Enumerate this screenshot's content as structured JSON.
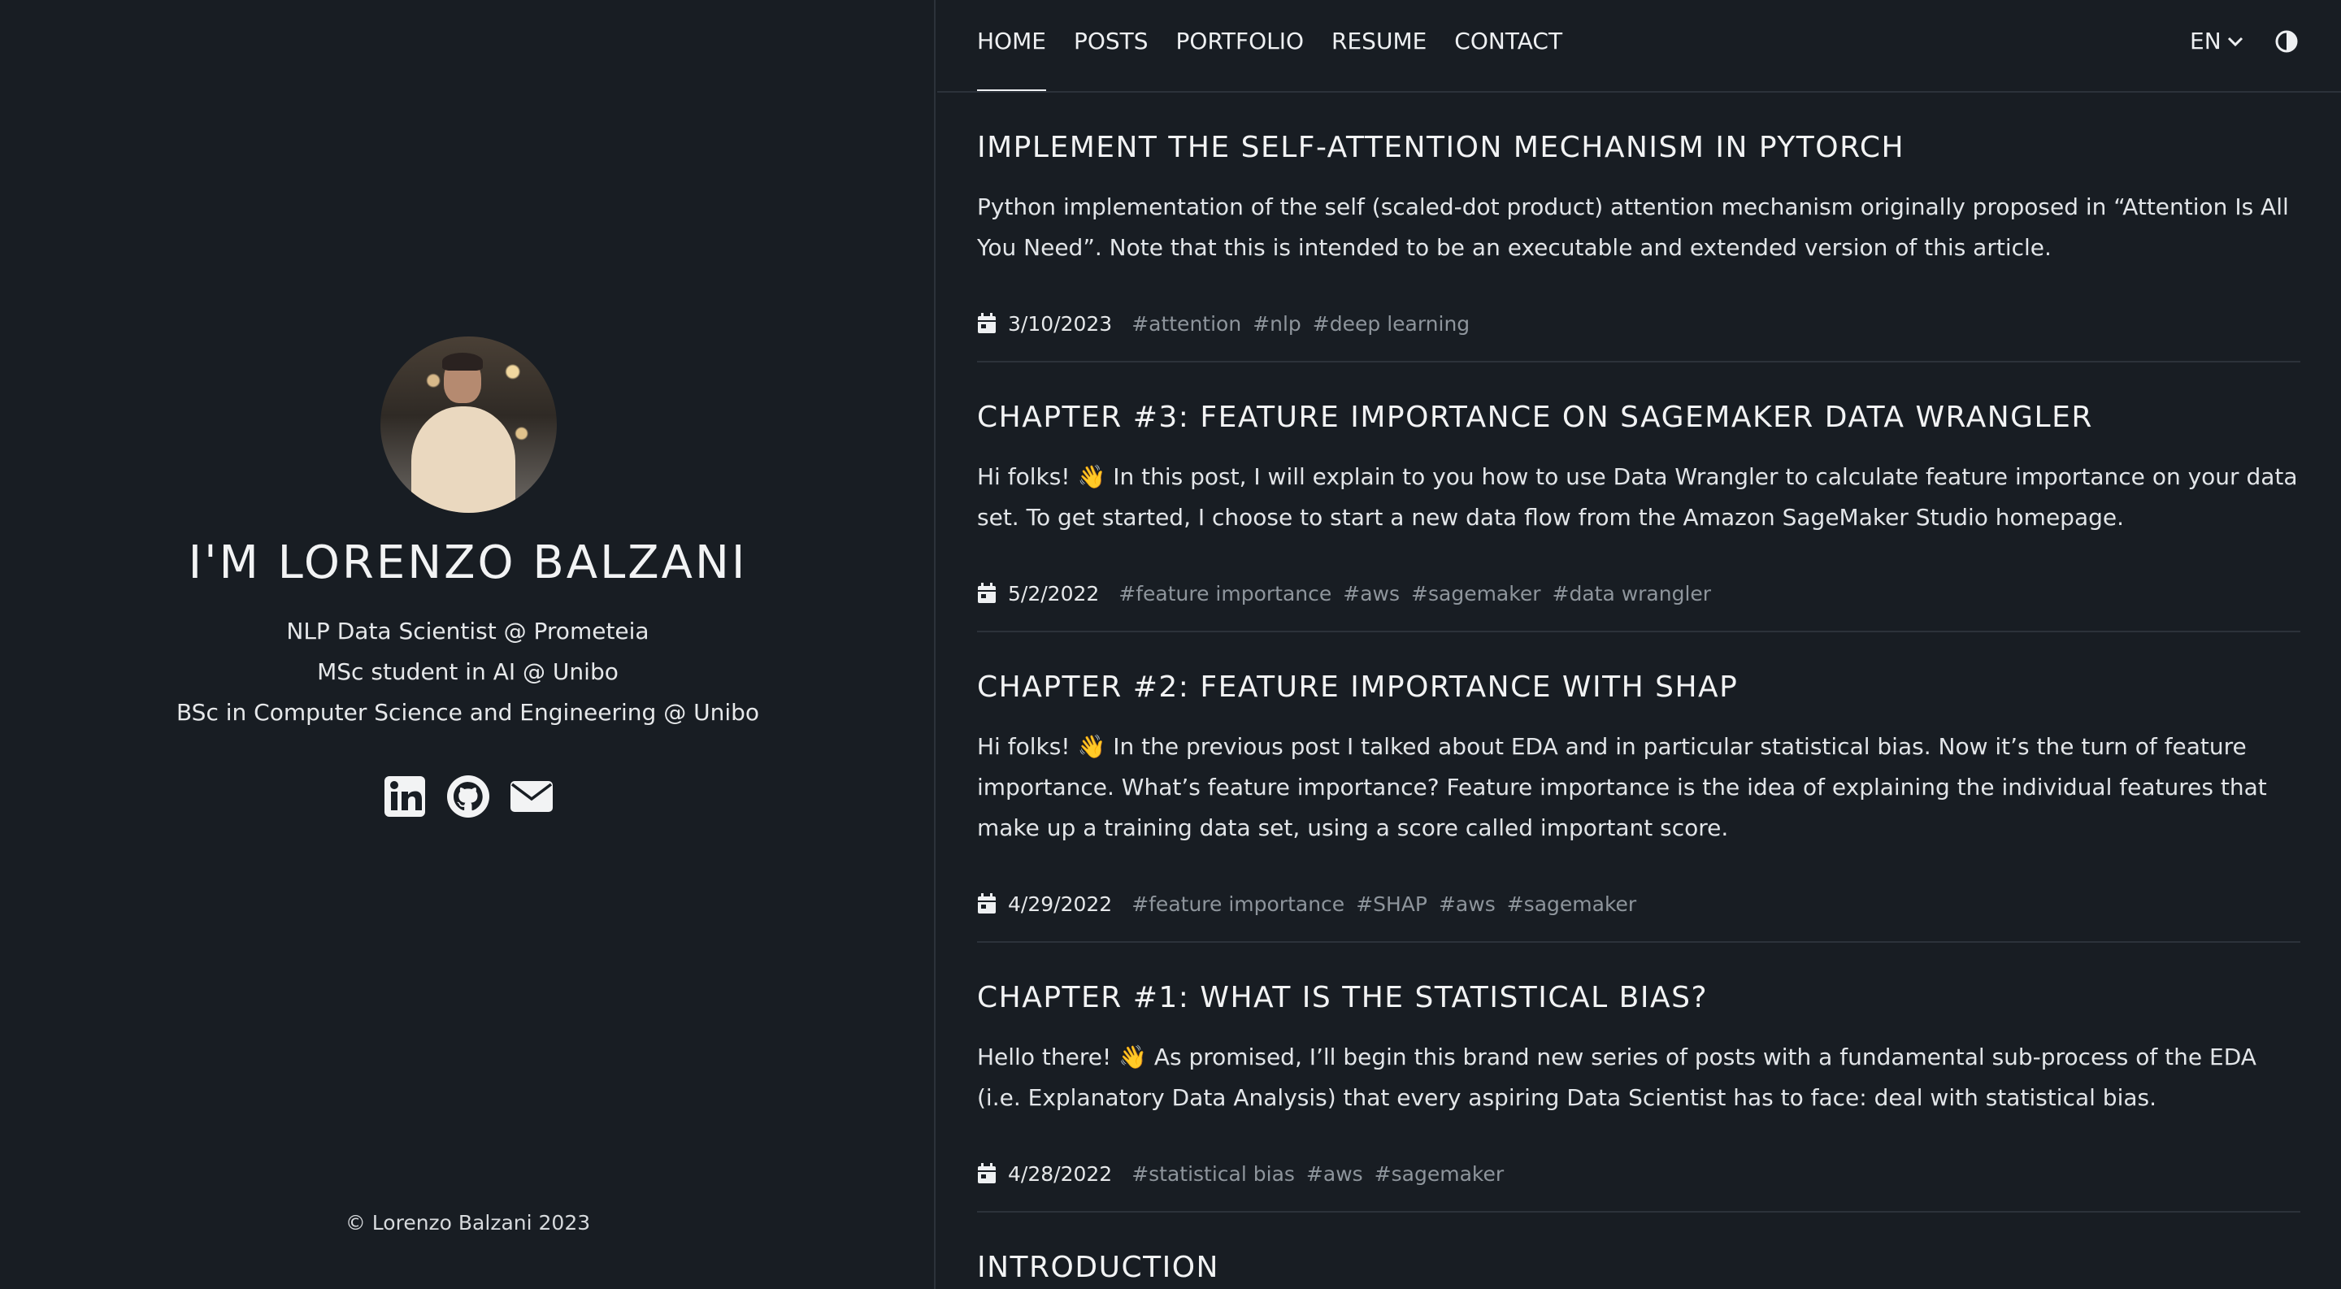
{
  "profile": {
    "title": "I'M LORENZO BALZANI",
    "lines": [
      "NLP Data Scientist @ Prometeia",
      "MSc student in AI @ Unibo",
      "BSc in Computer Science and Engineering @ Unibo"
    ],
    "socials": [
      "linkedin-icon",
      "github-icon",
      "envelope-icon"
    ],
    "copyright": "© Lorenzo Balzani 2023"
  },
  "nav": {
    "items": [
      {
        "label": "HOME",
        "active": true
      },
      {
        "label": "POSTS"
      },
      {
        "label": "PORTFOLIO"
      },
      {
        "label": "RESUME"
      },
      {
        "label": "CONTACT"
      }
    ],
    "language": "EN",
    "theme_icon": "contrast-icon"
  },
  "posts": [
    {
      "title": "IMPLEMENT THE SELF-ATTENTION MECHANISM IN PYTORCH",
      "excerpt": "Python implementation of the self (scaled-dot product) attention mechanism originally proposed in “Attention Is All You Need”. Note that this is intended to be an executable and extended version of this article.",
      "date": "3/10/2023",
      "tags": [
        "#attention",
        "#nlp",
        "#deep learning"
      ]
    },
    {
      "title": "CHAPTER #3: FEATURE IMPORTANCE ON SAGEMAKER DATA WRANGLER",
      "excerpt_before": "Hi folks!",
      "emoji": "👋",
      "excerpt": "In this post, I will explain to you how to use Data Wrangler to calculate feature importance on your data set. To get started, I choose to start a new data flow from the Amazon SageMaker Studio homepage.",
      "date": "5/2/2022",
      "tags": [
        "#feature importance",
        "#aws",
        "#sagemaker",
        "#data wrangler"
      ]
    },
    {
      "title": "CHAPTER #2: FEATURE IMPORTANCE WITH SHAP",
      "excerpt_before": "Hi folks!",
      "emoji": "👋",
      "excerpt": "In the previous post I talked about EDA and in particular statistical bias. Now it’s the turn of feature importance. What’s feature importance? Feature importance is the idea of explaining the individual features that make up a training data set, using a score called important score.",
      "date": "4/29/2022",
      "tags": [
        "#feature importance",
        "#SHAP",
        "#aws",
        "#sagemaker"
      ]
    },
    {
      "title": "CHAPTER #1: WHAT IS THE STATISTICAL BIAS?",
      "excerpt_before": "Hello there!",
      "emoji": "👋",
      "excerpt": "As promised, I’ll begin this brand new series of posts with a fundamental sub-process of the EDA (i.e. Explanatory Data Analysis) that every aspiring Data Scientist has to face: deal with statistical bias.",
      "date": "4/28/2022",
      "tags": [
        "#statistical bias",
        "#aws",
        "#sagemaker"
      ]
    },
    {
      "title": "INTRODUCTION"
    }
  ]
}
